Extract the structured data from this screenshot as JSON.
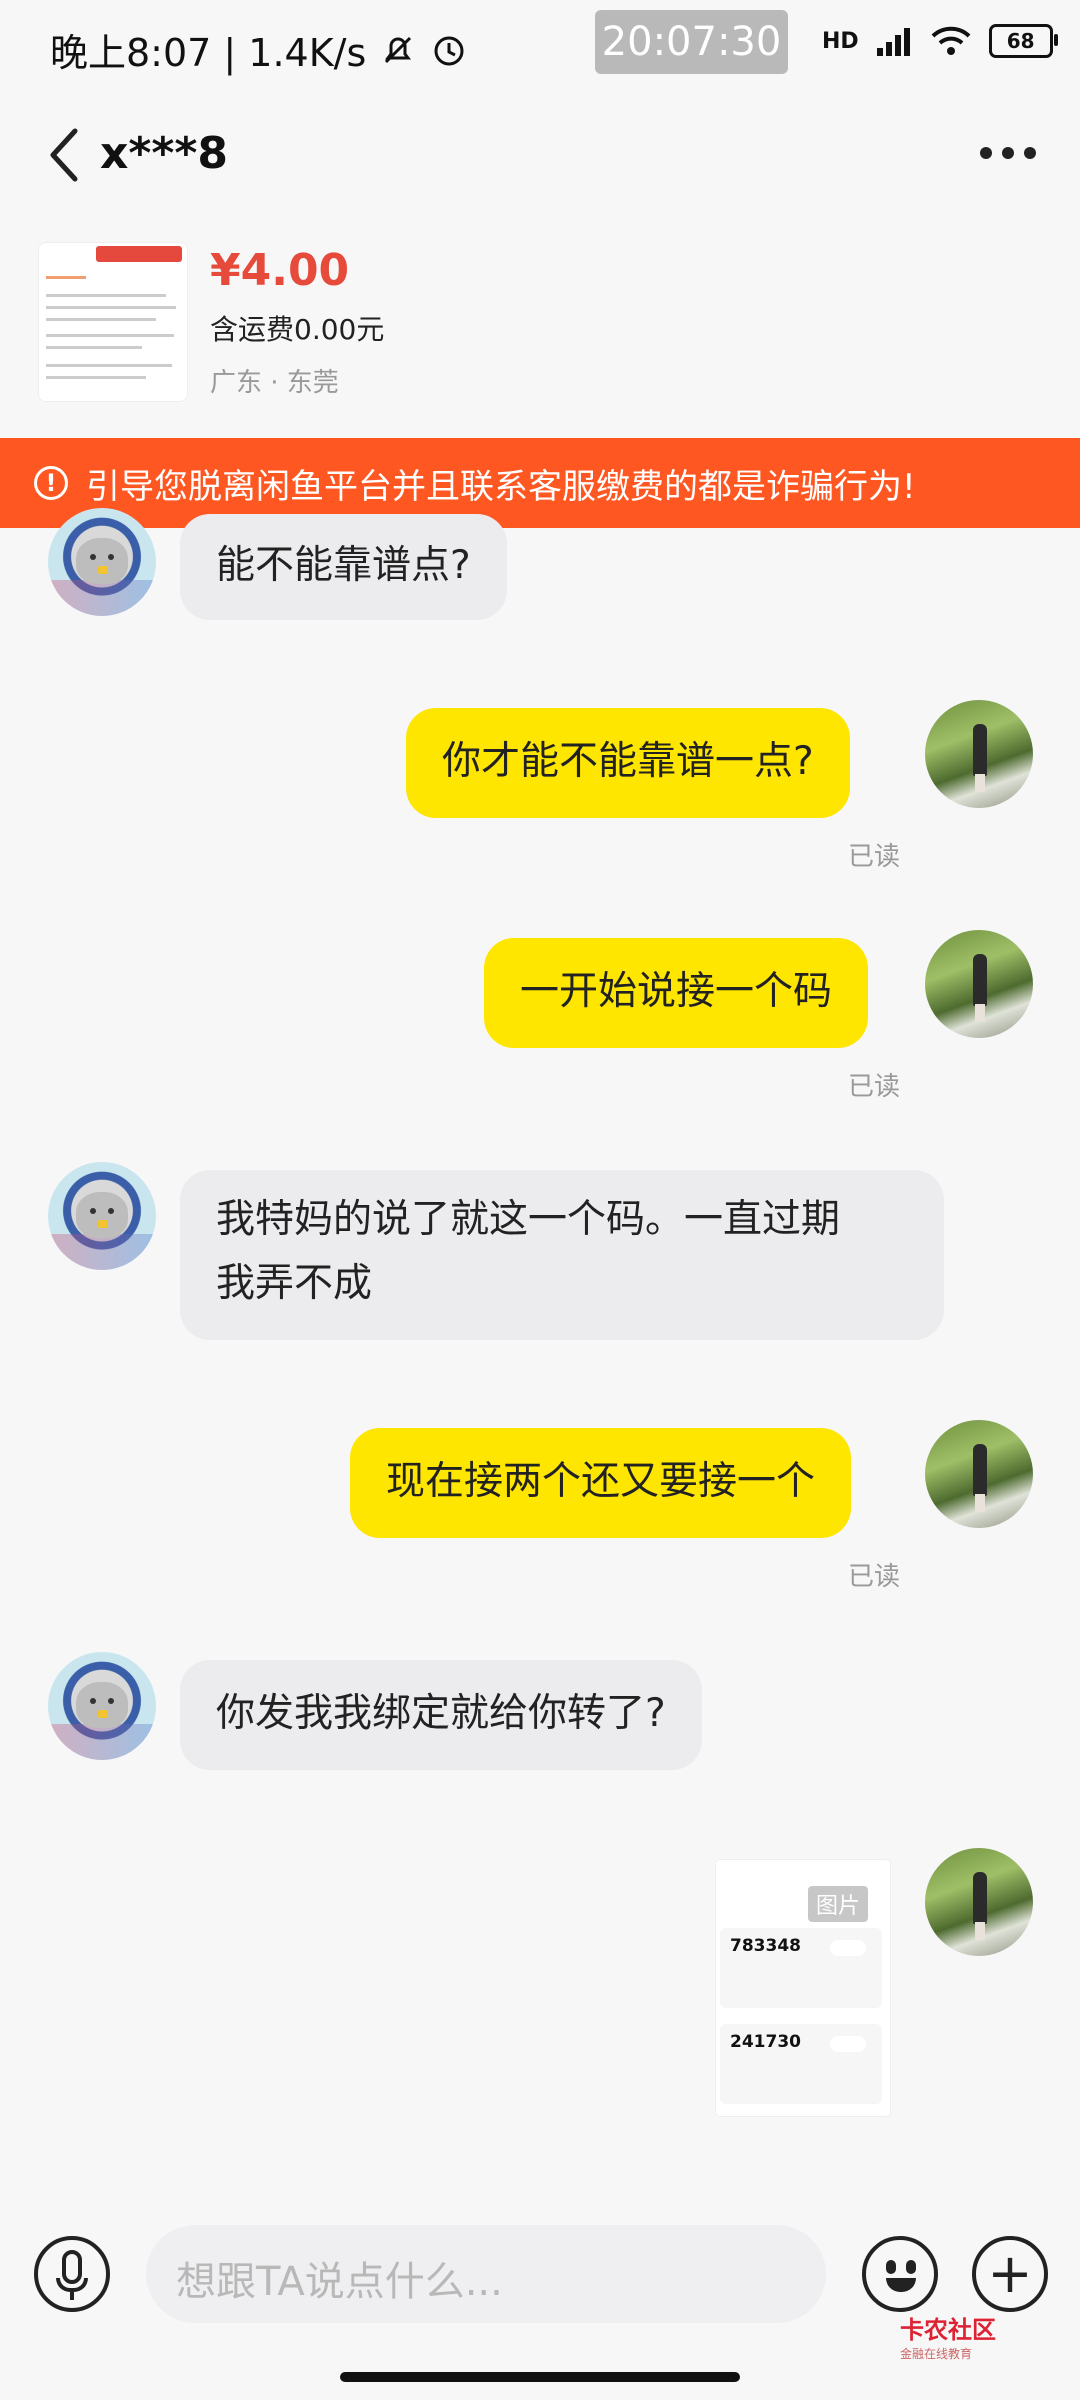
{
  "status_bar": {
    "left_text": "晚上8:07 | 1.4K/s",
    "time": "20:07:30",
    "network": "HD",
    "battery": "68"
  },
  "header": {
    "title": "x***8"
  },
  "product": {
    "price": "¥4.00",
    "freight": "含运费0.00元",
    "location": "广东 · 东莞"
  },
  "warning": {
    "text": "引导您脱离闲鱼平台并且联系客服缴费的都是诈骗行为!"
  },
  "messages": [
    {
      "side": "left",
      "text": "能不能靠谱点?"
    },
    {
      "side": "right",
      "text": "你才能不能靠谱一点?",
      "status": "已读"
    },
    {
      "side": "right",
      "text": "一开始说接一个码",
      "status": "已读"
    },
    {
      "side": "left",
      "line1": "我特妈的说了就这一个码。一直过期",
      "line2": "我弄不成"
    },
    {
      "side": "right",
      "text": "现在接两个还又要接一个",
      "status": "已读"
    },
    {
      "side": "left",
      "text": "你发我我绑定就给你转了?"
    },
    {
      "side": "right",
      "type": "image",
      "label": "图片",
      "codes": [
        "783348",
        "241730"
      ]
    }
  ],
  "input": {
    "placeholder": "想跟TA说点什么..."
  },
  "watermark": {
    "title": "卡农社区",
    "subtitle": "金融在线教育"
  },
  "colors": {
    "accent_yellow": "#ffe600",
    "warning_orange": "#ff5722",
    "price_red": "#e64a3b"
  }
}
